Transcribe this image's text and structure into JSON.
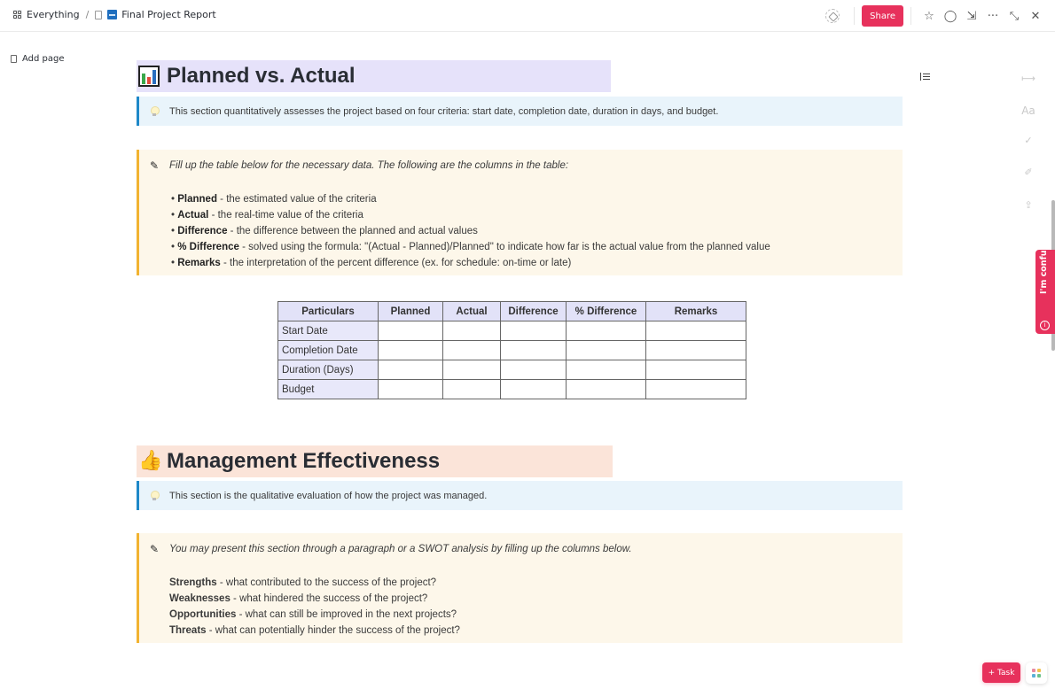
{
  "topbar": {
    "breadcrumb": {
      "workspace": "Everything",
      "separator": "/",
      "page": "Final Project Report"
    },
    "share_label": "Share",
    "icons": [
      "tag-icon",
      "star-icon",
      "comment-icon",
      "download-icon",
      "more-icon",
      "collapse-icon",
      "close-icon"
    ]
  },
  "sidebar": {
    "add_page_label": "Add page"
  },
  "sections": {
    "planned": {
      "title": "Planned vs. Actual",
      "callout_info": "This section quantitatively assesses the project based on four criteria: start date, completion date, duration in days, and budget.",
      "callout_note_intro": "Fill up the table below for the necessary data. The following are the columns in the table:",
      "bullets": [
        {
          "term": "Planned",
          "desc": " - the estimated value of the criteria"
        },
        {
          "term": "Actual",
          "desc": " - the real-time value of the criteria"
        },
        {
          "term": "Difference",
          "desc": " - the difference between the planned and actual values"
        },
        {
          "term": "% Difference",
          "desc": " - solved using the formula: \"(Actual - Planned)/Planned\" to indicate how far is the actual value from the planned value"
        },
        {
          "term": "Remarks",
          "desc": " - the interpretation of the percent difference (ex. for schedule: on-time or late)"
        }
      ],
      "table": {
        "headers": [
          "Particulars",
          "Planned",
          "Actual",
          "Difference",
          "% Difference",
          "Remarks"
        ],
        "rows": [
          [
            "Start Date",
            "",
            "",
            "",
            "",
            ""
          ],
          [
            "Completion Date",
            "",
            "",
            "",
            "",
            ""
          ],
          [
            "Duration (Days)",
            "",
            "",
            "",
            "",
            ""
          ],
          [
            "Budget",
            "",
            "",
            "",
            "",
            ""
          ]
        ]
      }
    },
    "management": {
      "title": "Management Effectiveness",
      "callout_info": "This section is the qualitative evaluation of how the project was managed.",
      "callout_note_intro": "You may present this section through a paragraph or a SWOT analysis by filling up the columns below.",
      "swot": [
        {
          "term": "Strengths",
          "desc": " - what contributed to the success of the project?"
        },
        {
          "term": "Weaknesses",
          "desc": " - what hindered the success of the project?"
        },
        {
          "term": "Opportunities",
          "desc": " - what can still be improved in the next projects?"
        },
        {
          "term": "Threats",
          "desc": " - what can potentially hinder the success of the project?"
        }
      ]
    }
  },
  "right_rail": {
    "font_label": "Aa",
    "icons": [
      "table-of-contents-icon",
      "collapse-right-icon",
      "font-icon",
      "sparkle-check-icon",
      "magic-wand-icon",
      "export-icon"
    ]
  },
  "feedback": {
    "label": "I'm confused"
  },
  "fab": {
    "task_label": "+ Task"
  },
  "colors": {
    "accent": "#e7315c",
    "info_border": "#1e88c8",
    "note_border": "#f2b330",
    "planned_heading_bg": "#e6e2fa",
    "management_heading_bg": "#fbe4d9"
  }
}
